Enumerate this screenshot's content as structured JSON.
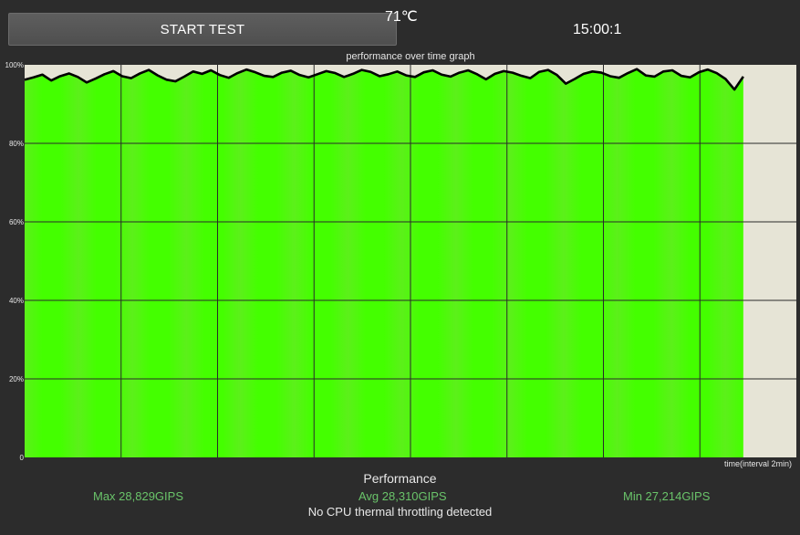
{
  "header": {
    "start_button_label": "START TEST",
    "temperature": "71℃",
    "timer": "15:00:1"
  },
  "graph": {
    "title": "performance over time graph",
    "x_axis_label": "time(interval 2min)",
    "colors": {
      "fill": "#44ff00",
      "fill_alt": "#5cf01a",
      "background": "#e6e4d6",
      "line": "#000000",
      "grid": "#2a2a2a"
    }
  },
  "chart_data": {
    "type": "area",
    "title": "performance over time graph",
    "xlabel": "time(interval 2min)",
    "ylabel": "",
    "ylim": [
      0,
      100
    ],
    "y_ticks": [
      "0",
      "20%",
      "40%",
      "60%",
      "80%",
      "100%"
    ],
    "x_range_min": [
      0,
      16
    ],
    "filled_to_min": 14.9,
    "grid": true,
    "series": [
      {
        "values": [
          96.2,
          96.8,
          97.5,
          96.0,
          97.1,
          97.8,
          96.9,
          95.5,
          96.5,
          97.6,
          98.4,
          97.1,
          96.6,
          97.8,
          98.7,
          97.3,
          96.2,
          95.8,
          97.0,
          98.3,
          97.7,
          98.6,
          97.4,
          96.7,
          97.9,
          98.8,
          98.1,
          97.2,
          96.9,
          98.0,
          98.5,
          97.4,
          96.8,
          97.6,
          98.4,
          97.9,
          96.9,
          97.7,
          98.7,
          98.2,
          97.1,
          97.6,
          98.3,
          97.3,
          96.9,
          98.1,
          98.6,
          97.5,
          97.0,
          98.0,
          98.6,
          97.6,
          96.3,
          97.7,
          98.4,
          98.0,
          97.2,
          96.6,
          98.2,
          98.7,
          97.4,
          95.2,
          96.4,
          97.7,
          98.3,
          98.0,
          97.1,
          96.7,
          97.9,
          98.9,
          97.3,
          97.0,
          98.3,
          98.6,
          97.2,
          96.8,
          98.1,
          98.8,
          97.9,
          96.4,
          93.7,
          97.0
        ]
      }
    ]
  },
  "stats": {
    "title": "Performance",
    "max": "Max 28,829GIPS",
    "avg": "Avg 28,310GIPS",
    "min": "Min 27,214GIPS",
    "throttling": "No CPU thermal throttling detected"
  }
}
